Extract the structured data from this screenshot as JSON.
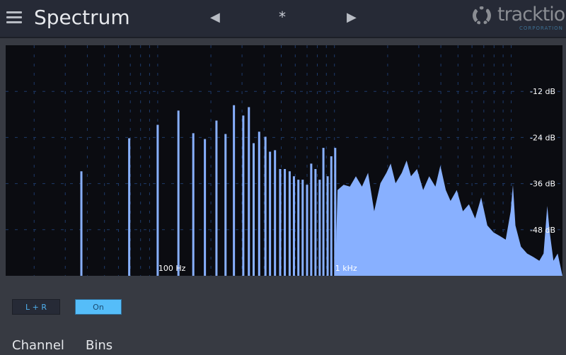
{
  "header": {
    "title": "Spectrum",
    "preset": "*",
    "prev_icon": "triangle-left",
    "next_icon": "triangle-right",
    "menu_icon": "hamburger",
    "logo": "tracktion",
    "logo_sub": "CORPORATION"
  },
  "controls": {
    "channel_value": "L + R",
    "bins_value": "On",
    "channel_label": "Channel",
    "bins_label": "Bins"
  },
  "colors": {
    "bar": "#88b0ff",
    "background": "#0b0c11",
    "panel": "#373a42",
    "header": "#262a36",
    "accent": "#55bdf9"
  },
  "chart_data": {
    "type": "area",
    "x_scale": "log",
    "xlim": [
      13.8,
      19500
    ],
    "ylim": [
      -60,
      0
    ],
    "x_labels": [
      {
        "freq": 100,
        "text": "100 Hz"
      },
      {
        "freq": 1000,
        "text": "1 kHz"
      }
    ],
    "y_labels": [
      {
        "db": -12,
        "text": "-12 dB"
      },
      {
        "db": -24,
        "text": "-24 dB"
      },
      {
        "db": -36,
        "text": "-36 dB"
      },
      {
        "db": -48,
        "text": "-48 dB"
      }
    ],
    "harmonic_lines": [
      [
        37,
        -32.8
      ],
      [
        69,
        -24.2
      ],
      [
        100,
        -20.7
      ],
      [
        131,
        -17.0
      ],
      [
        159,
        -22.9
      ],
      [
        185,
        -24.4
      ],
      [
        215,
        -19.6
      ],
      [
        242,
        -23.1
      ],
      [
        270,
        -15.6
      ],
      [
        305,
        -18.3
      ],
      [
        328,
        -16.1
      ],
      [
        349,
        -25.5
      ],
      [
        375,
        -22.5
      ],
      [
        407,
        -23.8
      ],
      [
        432,
        -27.7
      ],
      [
        461,
        -27.3
      ],
      [
        493,
        -32.2
      ],
      [
        524,
        -32.2
      ],
      [
        558,
        -32.8
      ],
      [
        590,
        -34.1
      ],
      [
        625,
        -35.0
      ],
      [
        661,
        -35.0
      ],
      [
        700,
        -36.3
      ],
      [
        739,
        -30.8
      ],
      [
        781,
        -32.2
      ],
      [
        825,
        -35.0
      ],
      [
        866,
        -26.7
      ],
      [
        915,
        -34.1
      ],
      [
        960,
        -28.9
      ],
      [
        1010,
        -26.7
      ]
    ],
    "area_points": [
      [
        1041,
        -37.7
      ],
      [
        1127,
        -36.3
      ],
      [
        1222,
        -36.8
      ],
      [
        1322,
        -34.1
      ],
      [
        1431,
        -36.8
      ],
      [
        1549,
        -33.2
      ],
      [
        1679,
        -43.2
      ],
      [
        1820,
        -35.9
      ],
      [
        1968,
        -33.2
      ],
      [
        2080,
        -30.8
      ],
      [
        2218,
        -35.9
      ],
      [
        2404,
        -33.2
      ],
      [
        2559,
        -30.0
      ],
      [
        2710,
        -34.1
      ],
      [
        2931,
        -32.2
      ],
      [
        3177,
        -37.7
      ],
      [
        3436,
        -34.1
      ],
      [
        3724,
        -36.8
      ],
      [
        3972,
        -31.3
      ],
      [
        4266,
        -37.7
      ],
      [
        4539,
        -40.5
      ],
      [
        4920,
        -37.7
      ],
      [
        5333,
        -43.2
      ],
      [
        5768,
        -41.4
      ],
      [
        6252,
        -45.1
      ],
      [
        6761,
        -39.6
      ],
      [
        7328,
        -46.9
      ],
      [
        7943,
        -48.7
      ],
      [
        8590,
        -49.6
      ],
      [
        9311,
        -50.6
      ],
      [
        9931,
        -43.2
      ],
      [
        10233,
        -36.3
      ],
      [
        10568,
        -46.9
      ],
      [
        11350,
        -52.4
      ],
      [
        12303,
        -54.2
      ],
      [
        13335,
        -55.1
      ],
      [
        14420,
        -56.1
      ],
      [
        15250,
        -54.2
      ],
      [
        16000,
        -41.8
      ],
      [
        16520,
        -48.7
      ],
      [
        17340,
        -56.1
      ],
      [
        18320,
        -54.2
      ]
    ]
  }
}
